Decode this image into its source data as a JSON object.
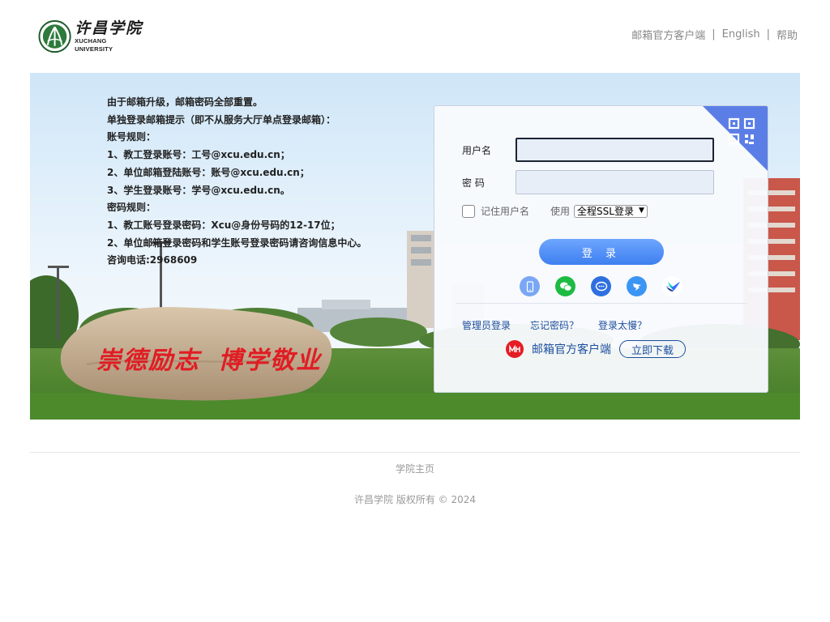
{
  "header": {
    "logo_cn": "许昌学院",
    "logo_en": "XUCHANG UNIVERSITY",
    "links": [
      {
        "label": "邮箱官方客户端"
      },
      {
        "label": "English"
      },
      {
        "label": "帮助"
      }
    ]
  },
  "banner": {
    "notice": [
      "由于邮箱升级，邮箱密码全部重置。",
      "单独登录邮箱提示（即不从服务大厅单点登录邮箱）：",
      "账号规则：",
      "1、教工登录账号：工号@xcu.edu.cn；",
      "2、单位邮箱登陆账号：账号@xcu.edu.cn；",
      "3、学生登录账号：学号@xcu.edu.cn。",
      "密码规则：",
      "1、教工账号登录密码：Xcu@身份号码的12-17位；",
      "2、单位邮箱登录密码和学生账号登录密码请咨询信息中心。",
      "咨询电话:2968609"
    ],
    "stone_text_1": "崇德励志",
    "stone_text_2": "博学敬业"
  },
  "login": {
    "username_label": "用户名",
    "password_label": "密 码",
    "username_value": "",
    "password_value": "",
    "remember_label": "记住用户名",
    "use_label": "使用",
    "ssl_option": "全程SSL登录",
    "login_button": "登 录",
    "third_party_icons": [
      "mobile-icon",
      "wechat-icon",
      "chat-bubble-icon",
      "dingtalk-icon",
      "feishu-icon"
    ],
    "admin_login": "管理员登录",
    "forgot_password": "忘记密码？",
    "slow_login": "登录太慢？",
    "client_name": "邮箱官方客户端",
    "download_button": "立即下载"
  },
  "footer": {
    "home_link": "学院主页",
    "copyright": "许昌学院 版权所有 © 2024"
  },
  "colors": {
    "accent_blue": "#3d7fef",
    "link_blue": "#1c4e9d",
    "stone_red": "#e01d24",
    "qr_corner": "#5b7ee6"
  }
}
